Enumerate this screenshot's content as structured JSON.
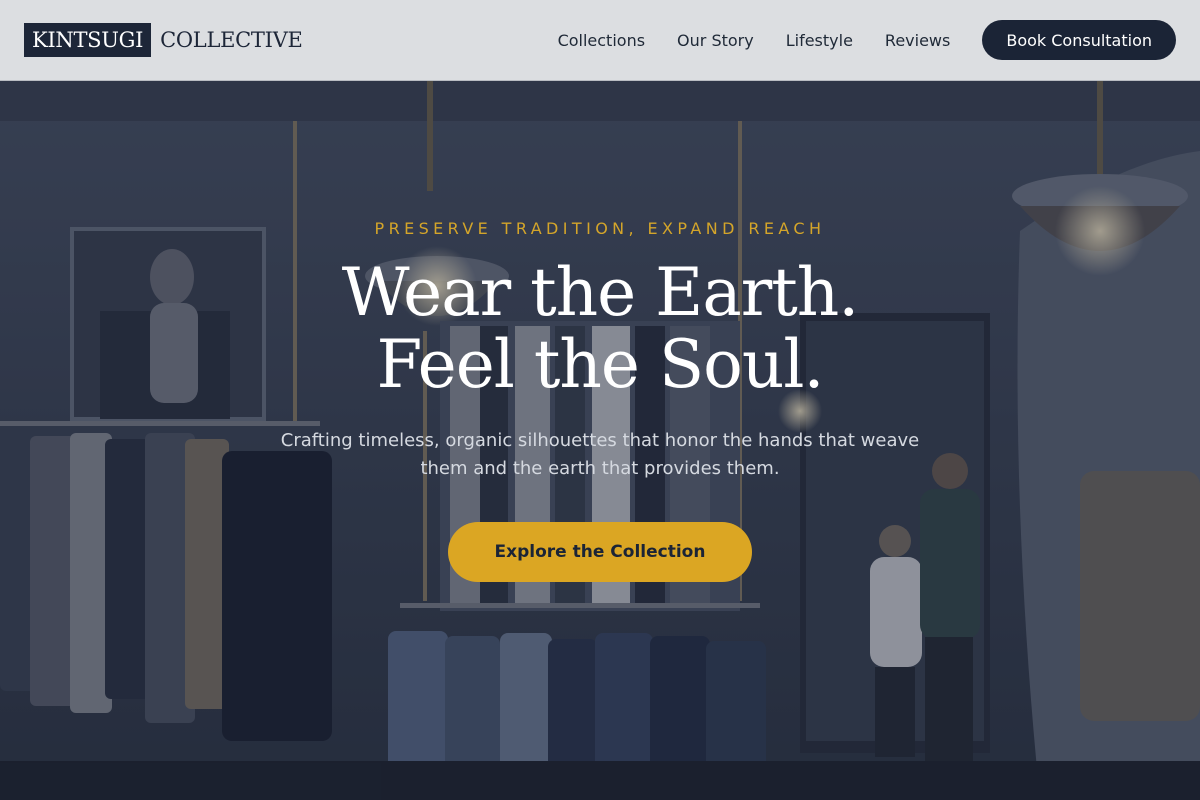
{
  "brand": {
    "logo_boxed": "KINTSUGI",
    "logo_rest": "COLLECTIVE"
  },
  "nav": {
    "items": [
      {
        "label": "Collections"
      },
      {
        "label": "Our Story"
      },
      {
        "label": "Lifestyle"
      },
      {
        "label": "Reviews"
      }
    ],
    "cta_label": "Book Consultation"
  },
  "hero": {
    "eyebrow": "PRESERVE TRADITION, EXPAND REACH",
    "headline_line1": "Wear the Earth.",
    "headline_line2": "Feel the Soul.",
    "subtext": "Crafting timeless, organic silhouettes that honor the hands that weave them and the earth that provides them.",
    "cta_label": "Explore the Collection"
  },
  "colors": {
    "navy": "#1b2436",
    "gold": "#dba623",
    "header_bg": "#dcdee1"
  }
}
